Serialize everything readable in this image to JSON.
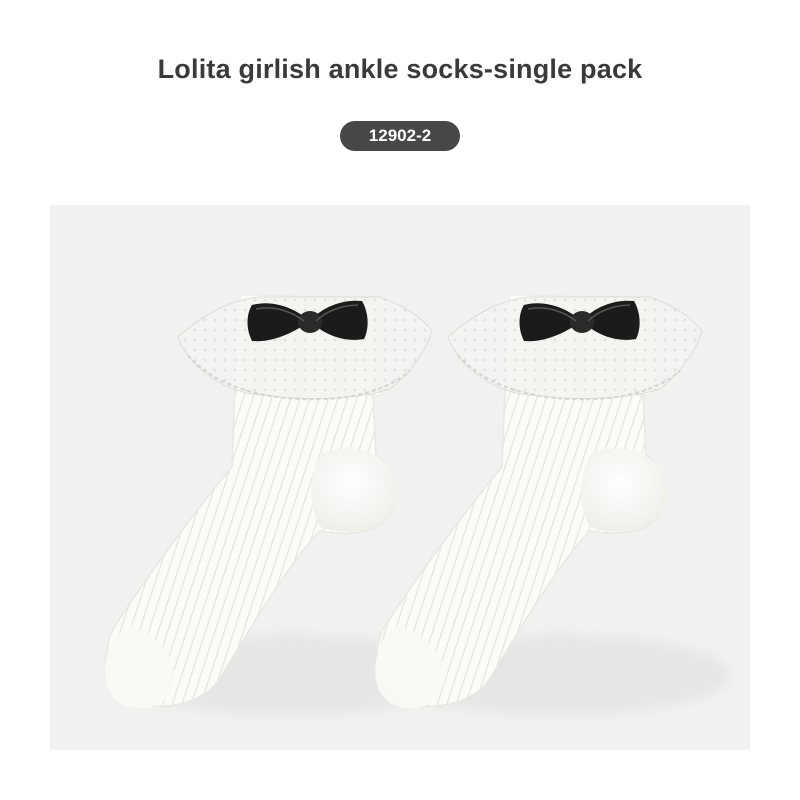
{
  "title": "Lolita girlish ankle socks-single pack",
  "badge": "12902-2",
  "product_image": {
    "subject": "product-photo",
    "colors": {
      "background": "#f1f1f1",
      "sock": "#fbfbf7",
      "bow": "#1b1b1b",
      "badge": "#474747",
      "title_text": "#3a3a3a"
    }
  }
}
